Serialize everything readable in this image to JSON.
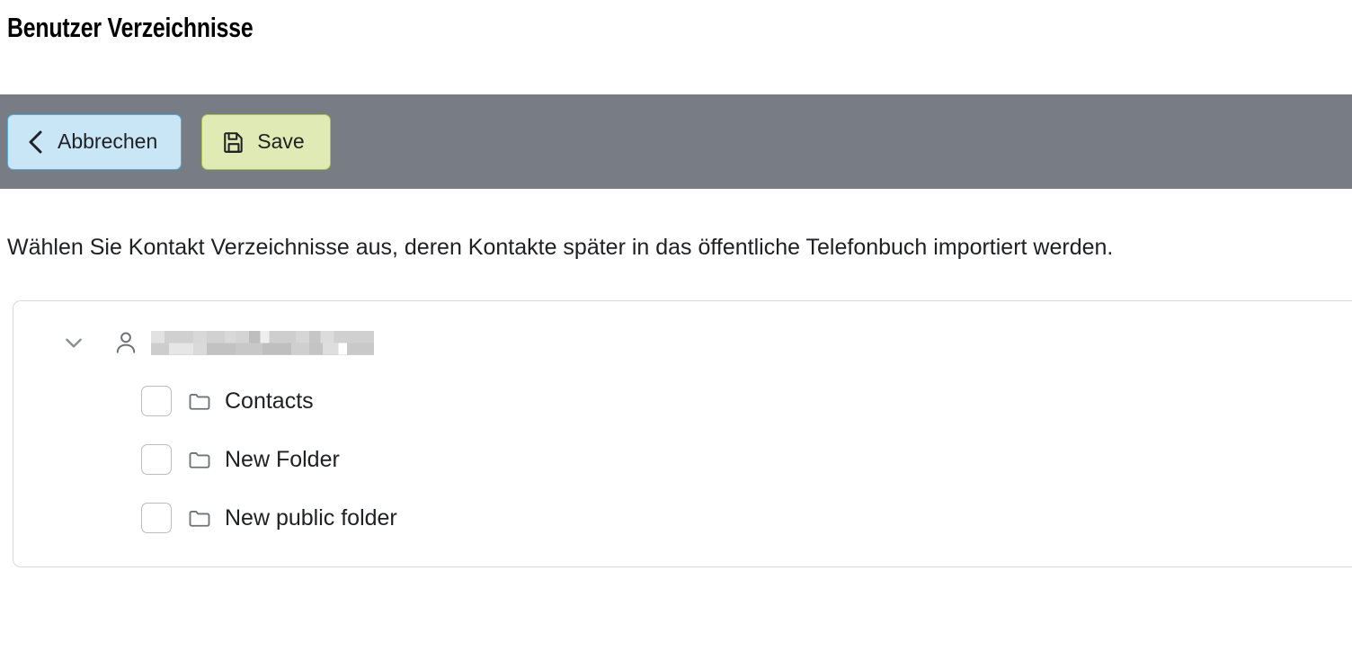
{
  "page": {
    "title": "Benutzer Verzeichnisse"
  },
  "toolbar": {
    "background_color": "#787d85",
    "cancel": {
      "label": "Abbrechen",
      "icon": "chevron-left-icon",
      "background_color": "#c9e6f7",
      "border_color": "#5aa9de"
    },
    "save": {
      "label": "Save",
      "icon": "floppy-disk-icon",
      "background_color": "#dfeab4",
      "border_color": "#a8c04e"
    }
  },
  "main": {
    "description": "Wählen Sie Kontakt Verzeichnisse aus, deren Kontakte später in das öffentliche Telefonbuch importiert werden.",
    "tree": {
      "root": {
        "expander_icon": "chevron-down-icon",
        "expanded": true,
        "icon": "user-icon",
        "label": "",
        "label_redacted": true
      },
      "folders": [
        {
          "label": "Contacts",
          "icon": "folder-icon",
          "checked": false
        },
        {
          "label": "New Folder",
          "icon": "folder-icon",
          "checked": false
        },
        {
          "label": "New public folder",
          "icon": "folder-icon",
          "checked": false
        }
      ]
    }
  }
}
